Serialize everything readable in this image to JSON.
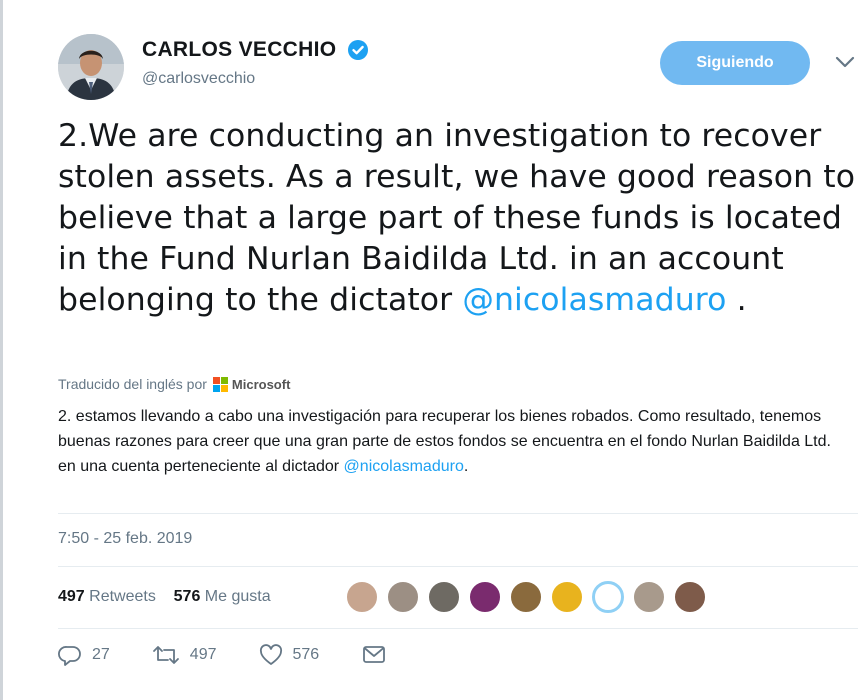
{
  "author": {
    "display_name": "CARLOS VECCHIO",
    "handle": "@carlosvecchio",
    "verified": true
  },
  "follow_button": {
    "label": "Siguiendo",
    "color": "#71b9f1"
  },
  "tweet": {
    "text_before": "2.We are conducting an investigation to recover stolen assets. As a result, we have good reason to believe that a large part of these funds is located in the Fund Nurlan Baidilda Ltd. in an account belonging to the dictator ",
    "mention": "@nicolasmaduro",
    "text_after": " ."
  },
  "translation": {
    "label": "Traducido del inglés por",
    "provider": "Microsoft",
    "text": "2. estamos llevando a cabo una investigación para recuperar los bienes robados. Como resultado, tenemos buenas razones para creer que una gran parte de estos fondos se encuentra en el fondo Nurlan Baidilda Ltd. en una cuenta perteneciente al dictador ",
    "mention": "@nicolasmaduro",
    "text_after": "."
  },
  "timestamp": "7:50 - 25 feb. 2019",
  "stats": {
    "retweets_count": "497",
    "retweets_label": "Retweets",
    "likes_count": "576",
    "likes_label": "Me gusta"
  },
  "likers": [
    {
      "name": "liker-1",
      "color": "#c7a58f"
    },
    {
      "name": "liker-2",
      "color": "#9c8f84"
    },
    {
      "name": "liker-3",
      "color": "#6e6a63"
    },
    {
      "name": "liker-4",
      "color": "#7a2b6e"
    },
    {
      "name": "liker-5",
      "color": "#8a6a3d"
    },
    {
      "name": "liker-6",
      "color": "#e8b31e"
    },
    {
      "name": "liker-7",
      "color": "#bfe3f7"
    },
    {
      "name": "liker-8",
      "color": "#a89a8c"
    },
    {
      "name": "liker-9",
      "color": "#7e5b4a"
    }
  ],
  "actions": {
    "reply_count": "27",
    "retweet_count": "497",
    "like_count": "576"
  },
  "colors": {
    "accent": "#1da1f2",
    "secondary_text": "#657786"
  }
}
